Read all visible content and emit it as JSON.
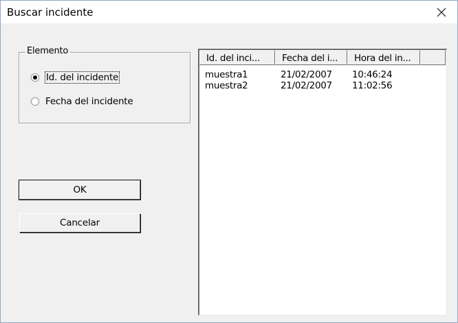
{
  "window": {
    "title": "Buscar incidente",
    "close_icon": "close-icon"
  },
  "group": {
    "legend": "Elemento",
    "options": [
      {
        "label": "Id. del incidente",
        "checked": true
      },
      {
        "label": "Fecha del incidente",
        "checked": false
      }
    ]
  },
  "buttons": {
    "ok_label": "OK",
    "cancel_label": "Cancelar"
  },
  "list": {
    "columns": [
      "Id. del inci...",
      "Fecha del i...",
      "Hora del in...",
      ""
    ],
    "rows": [
      [
        "muestra1",
        "21/02/2007",
        "10:46:24"
      ],
      [
        "muestra2",
        "21/02/2007",
        "11:02:56"
      ]
    ]
  },
  "colors": {
    "dialog_bg": "#f0f0f0",
    "titlebar_bg": "#ffffff",
    "window_border": "#8fa7c8"
  }
}
